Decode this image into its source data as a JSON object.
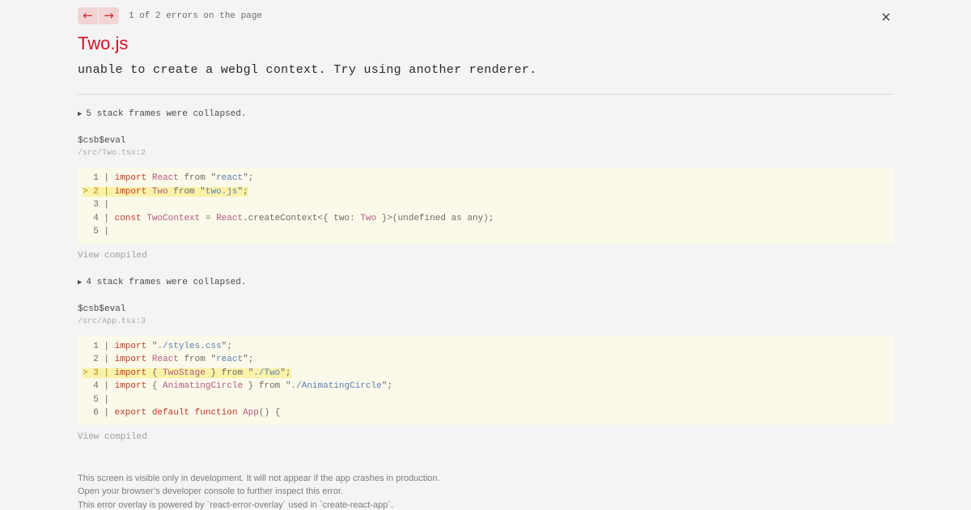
{
  "nav": {
    "prev_label": "←",
    "next_label": "→",
    "counter": "1 of 2 errors on the page"
  },
  "close_label": "×",
  "error": {
    "title": "Two.js",
    "message": "unable to create a webgl context. Try using another renderer."
  },
  "frames": [
    {
      "collapsed": "5 stack frames were collapsed.",
      "function": "$csb$eval",
      "file": "/src/Two.tsx:2",
      "view_compiled": "View compiled",
      "lines": [
        {
          "gutter": "  1 | ",
          "highlight": false,
          "tokens": [
            {
              "t": "import",
              "c": "kw"
            },
            {
              "t": " ",
              "c": "plain"
            },
            {
              "t": "React",
              "c": "id"
            },
            {
              "t": " from ",
              "c": "plain"
            },
            {
              "t": "\"",
              "c": "str-q"
            },
            {
              "t": "react",
              "c": "str"
            },
            {
              "t": "\"",
              "c": "str-q"
            },
            {
              "t": ";",
              "c": "plain"
            }
          ]
        },
        {
          "gutter": "> 2 | ",
          "highlight": true,
          "tokens": [
            {
              "t": "import",
              "c": "kw"
            },
            {
              "t": " ",
              "c": "plain"
            },
            {
              "t": "Two",
              "c": "id"
            },
            {
              "t": " from ",
              "c": "plain"
            },
            {
              "t": "\"",
              "c": "str-q"
            },
            {
              "t": "two.js",
              "c": "str"
            },
            {
              "t": "\"",
              "c": "str-q"
            },
            {
              "t": ";",
              "c": "plain"
            }
          ]
        },
        {
          "gutter": "  3 | ",
          "highlight": false,
          "tokens": []
        },
        {
          "gutter": "  4 | ",
          "highlight": false,
          "tokens": [
            {
              "t": "const",
              "c": "kw"
            },
            {
              "t": " ",
              "c": "plain"
            },
            {
              "t": "TwoContext",
              "c": "id"
            },
            {
              "t": " = ",
              "c": "plain"
            },
            {
              "t": "React",
              "c": "id"
            },
            {
              "t": ".createContext<{ two: ",
              "c": "plain"
            },
            {
              "t": "Two",
              "c": "id"
            },
            {
              "t": " }>(undefined as any);",
              "c": "plain"
            }
          ]
        },
        {
          "gutter": "  5 | ",
          "highlight": false,
          "tokens": []
        }
      ]
    },
    {
      "collapsed": "4 stack frames were collapsed.",
      "function": "$csb$eval",
      "file": "/src/App.tsx:3",
      "view_compiled": "View compiled",
      "lines": [
        {
          "gutter": "  1 | ",
          "highlight": false,
          "tokens": [
            {
              "t": "import",
              "c": "kw"
            },
            {
              "t": " ",
              "c": "plain"
            },
            {
              "t": "\"",
              "c": "str-q"
            },
            {
              "t": "./styles.css",
              "c": "str"
            },
            {
              "t": "\"",
              "c": "str-q"
            },
            {
              "t": ";",
              "c": "plain"
            }
          ]
        },
        {
          "gutter": "  2 | ",
          "highlight": false,
          "tokens": [
            {
              "t": "import",
              "c": "kw"
            },
            {
              "t": " ",
              "c": "plain"
            },
            {
              "t": "React",
              "c": "id"
            },
            {
              "t": " from ",
              "c": "plain"
            },
            {
              "t": "\"",
              "c": "str-q"
            },
            {
              "t": "react",
              "c": "str"
            },
            {
              "t": "\"",
              "c": "str-q"
            },
            {
              "t": ";",
              "c": "plain"
            }
          ]
        },
        {
          "gutter": "> 3 | ",
          "highlight": true,
          "tokens": [
            {
              "t": "import",
              "c": "kw"
            },
            {
              "t": " { ",
              "c": "plain"
            },
            {
              "t": "TwoStage",
              "c": "id"
            },
            {
              "t": " } from ",
              "c": "plain"
            },
            {
              "t": "\"",
              "c": "str-q"
            },
            {
              "t": "./Two",
              "c": "str"
            },
            {
              "t": "\"",
              "c": "str-q"
            },
            {
              "t": ";",
              "c": "plain"
            }
          ]
        },
        {
          "gutter": "  4 | ",
          "highlight": false,
          "tokens": [
            {
              "t": "import",
              "c": "kw"
            },
            {
              "t": " { ",
              "c": "plain"
            },
            {
              "t": "AnimatingCircle",
              "c": "id"
            },
            {
              "t": " } from ",
              "c": "plain"
            },
            {
              "t": "\"",
              "c": "str-q"
            },
            {
              "t": "./AnimatingCircle",
              "c": "str"
            },
            {
              "t": "\"",
              "c": "str-q"
            },
            {
              "t": ";",
              "c": "plain"
            }
          ]
        },
        {
          "gutter": "  5 | ",
          "highlight": false,
          "tokens": []
        },
        {
          "gutter": "  6 | ",
          "highlight": false,
          "tokens": [
            {
              "t": "export",
              "c": "kw"
            },
            {
              "t": " ",
              "c": "plain"
            },
            {
              "t": "default",
              "c": "kw"
            },
            {
              "t": " ",
              "c": "plain"
            },
            {
              "t": "function",
              "c": "kw"
            },
            {
              "t": " ",
              "c": "plain"
            },
            {
              "t": "App",
              "c": "id"
            },
            {
              "t": "() {",
              "c": "plain"
            }
          ]
        }
      ]
    }
  ],
  "footer": [
    "This screen is visible only in development. It will not appear if the app crashes in production.",
    "Open your browser’s developer console to further inspect this error.",
    "This error overlay is powered by `react-error-overlay` used in `create-react-app`."
  ],
  "colors": {
    "title": "#ce1126",
    "nav_bg": "#f1d4d4",
    "nav_fg": "#cf2c2c",
    "code_bg": "#fbf9e9",
    "code_highlight": "#faf2a8",
    "page_bg": "#f4f4f4"
  }
}
